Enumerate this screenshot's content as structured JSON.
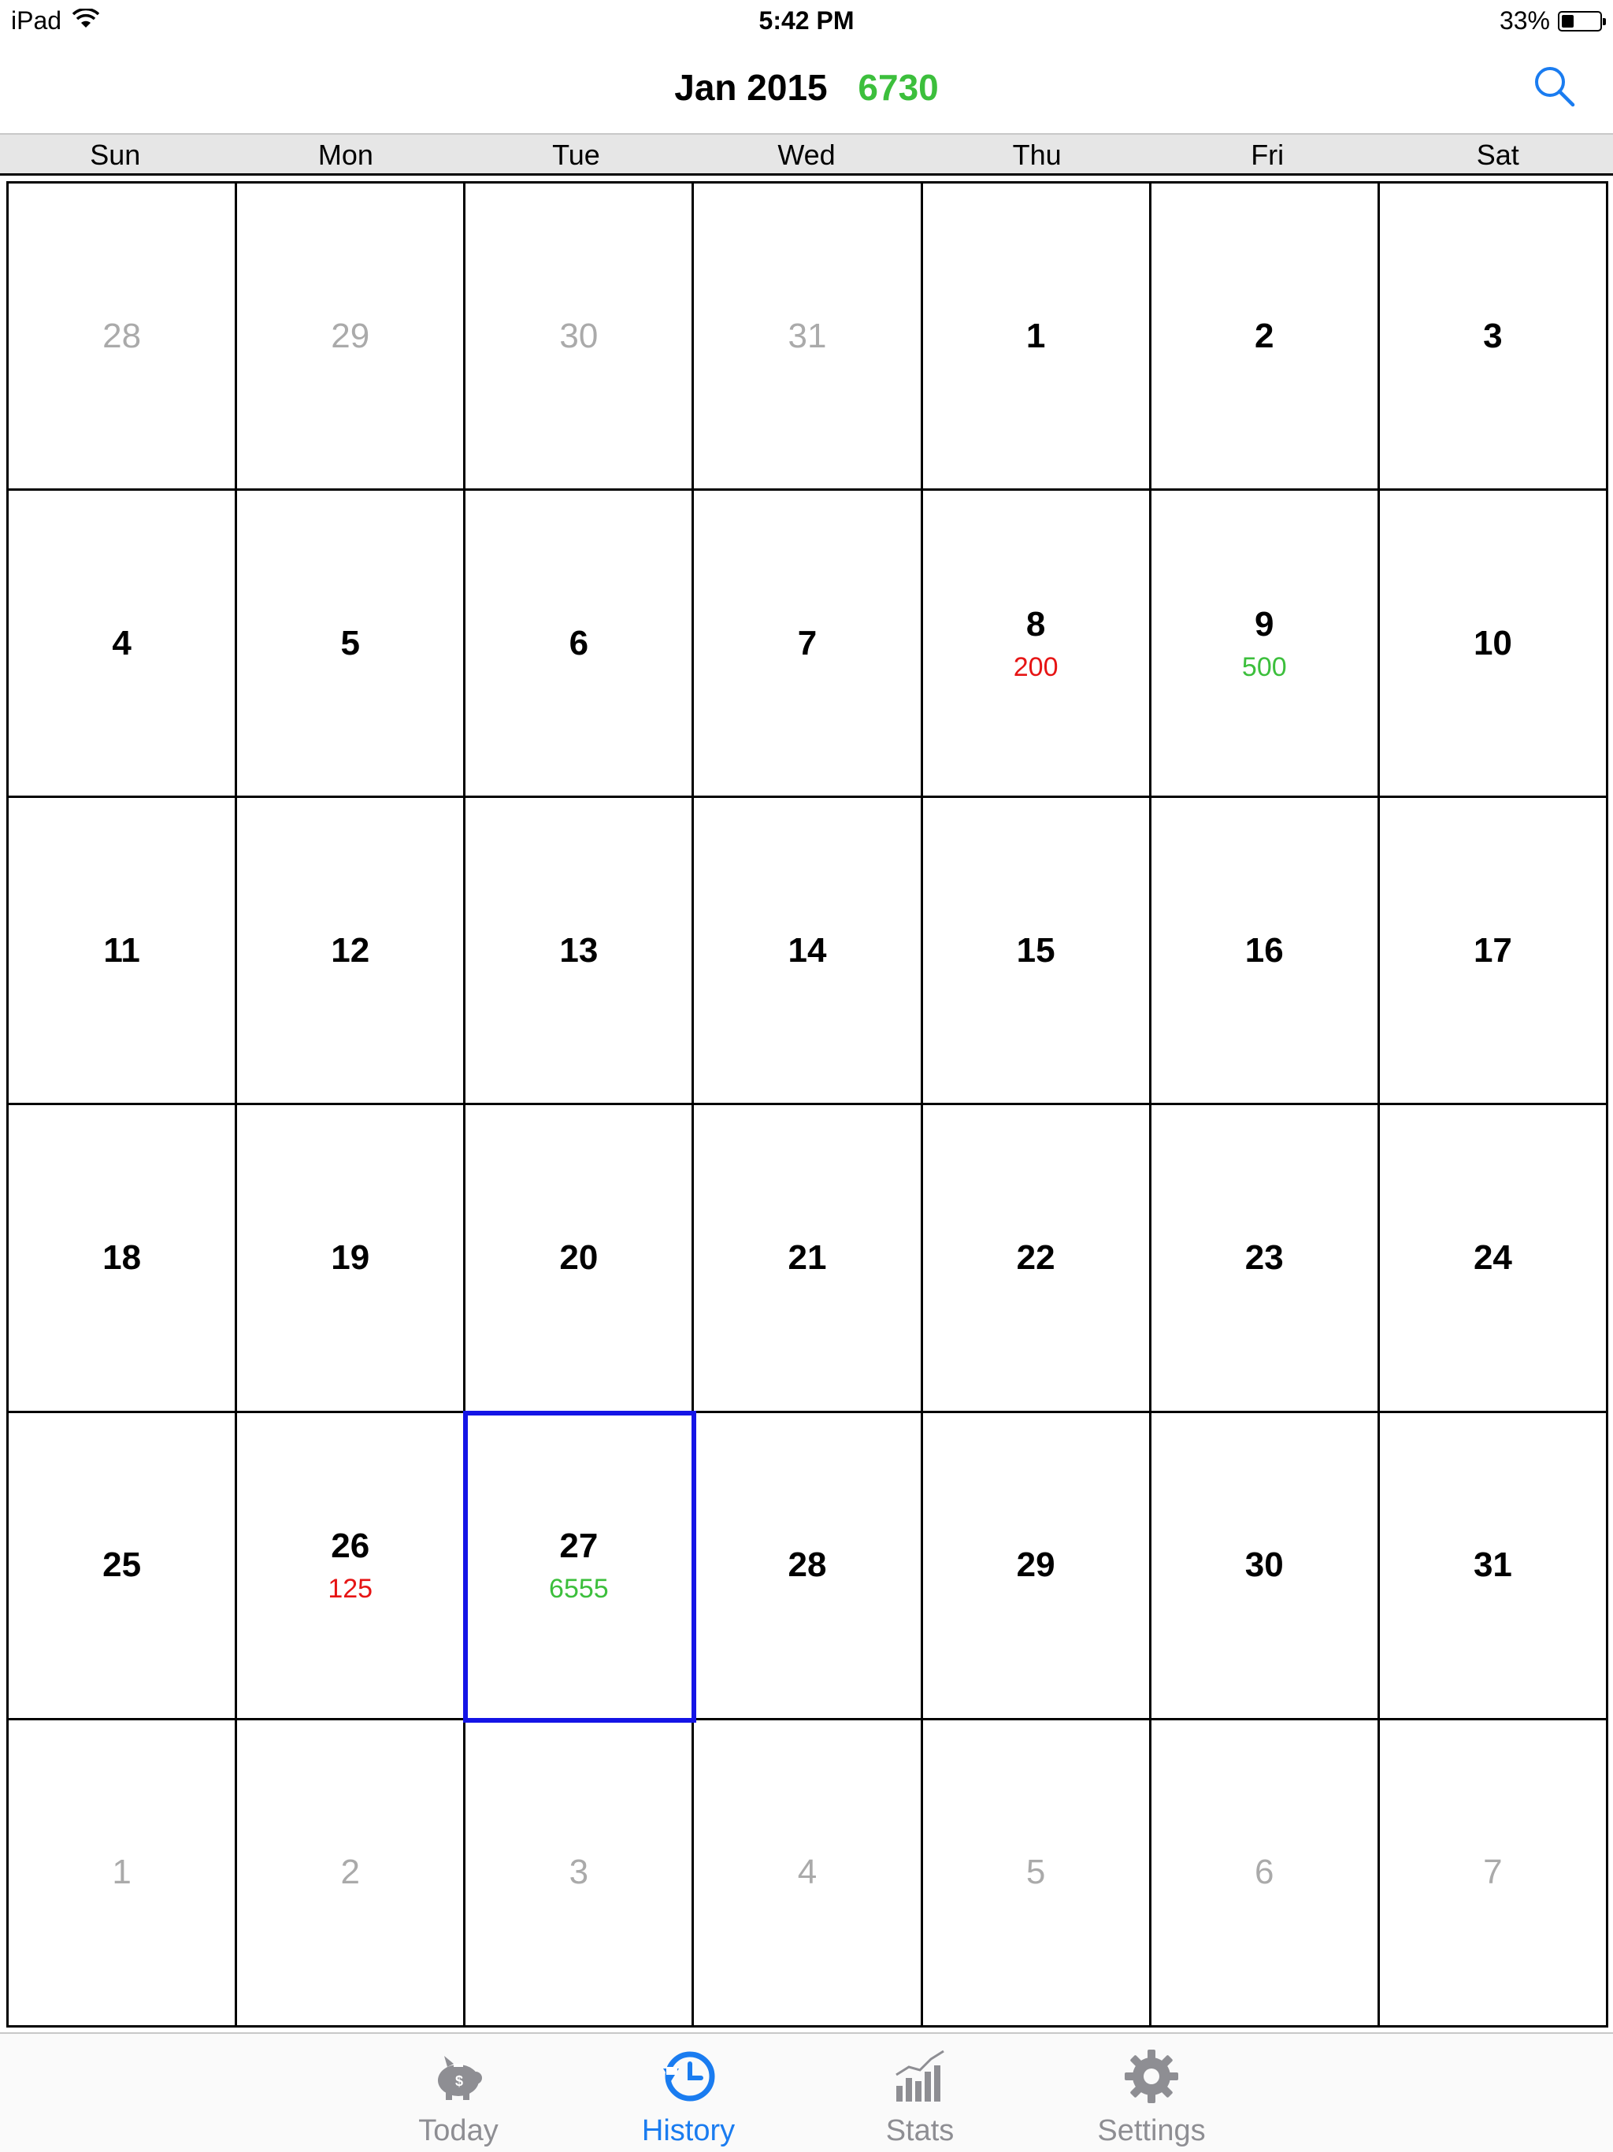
{
  "status_bar": {
    "device": "iPad",
    "time": "5:42 PM",
    "battery": "33%",
    "battery_level": 0.33
  },
  "header": {
    "title": "Jan 2015",
    "total": "6730",
    "total_color": "#3cbf3c"
  },
  "colors": {
    "expense": "#e61414",
    "income": "#3cbf3c",
    "accent": "#1a7cf0",
    "selected_border": "#1414e6"
  },
  "weekdays": [
    "Sun",
    "Mon",
    "Tue",
    "Wed",
    "Thu",
    "Fri",
    "Sat"
  ],
  "calendar": {
    "days": [
      {
        "day": "28",
        "other_month": true
      },
      {
        "day": "29",
        "other_month": true
      },
      {
        "day": "30",
        "other_month": true
      },
      {
        "day": "31",
        "other_month": true
      },
      {
        "day": "1"
      },
      {
        "day": "2"
      },
      {
        "day": "3"
      },
      {
        "day": "4"
      },
      {
        "day": "5"
      },
      {
        "day": "6"
      },
      {
        "day": "7"
      },
      {
        "day": "8",
        "amount": "200",
        "kind": "expense"
      },
      {
        "day": "9",
        "amount": "500",
        "kind": "income"
      },
      {
        "day": "10"
      },
      {
        "day": "11"
      },
      {
        "day": "12"
      },
      {
        "day": "13"
      },
      {
        "day": "14"
      },
      {
        "day": "15"
      },
      {
        "day": "16"
      },
      {
        "day": "17"
      },
      {
        "day": "18"
      },
      {
        "day": "19"
      },
      {
        "day": "20"
      },
      {
        "day": "21"
      },
      {
        "day": "22"
      },
      {
        "day": "23"
      },
      {
        "day": "24"
      },
      {
        "day": "25"
      },
      {
        "day": "26",
        "amount": "125",
        "kind": "expense"
      },
      {
        "day": "27",
        "amount": "6555",
        "kind": "income",
        "selected": true
      },
      {
        "day": "28"
      },
      {
        "day": "29"
      },
      {
        "day": "30"
      },
      {
        "day": "31"
      },
      {
        "day": "1",
        "other_month": true
      },
      {
        "day": "2",
        "other_month": true
      },
      {
        "day": "3",
        "other_month": true
      },
      {
        "day": "4",
        "other_month": true
      },
      {
        "day": "5",
        "other_month": true
      },
      {
        "day": "6",
        "other_month": true
      },
      {
        "day": "7",
        "other_month": true
      }
    ]
  },
  "tabs": [
    {
      "label": "Today",
      "icon": "piggy-bank-icon",
      "active": false
    },
    {
      "label": "History",
      "icon": "history-clock-icon",
      "active": true
    },
    {
      "label": "Stats",
      "icon": "bar-chart-icon",
      "active": false
    },
    {
      "label": "Settings",
      "icon": "gear-icon",
      "active": false
    }
  ]
}
